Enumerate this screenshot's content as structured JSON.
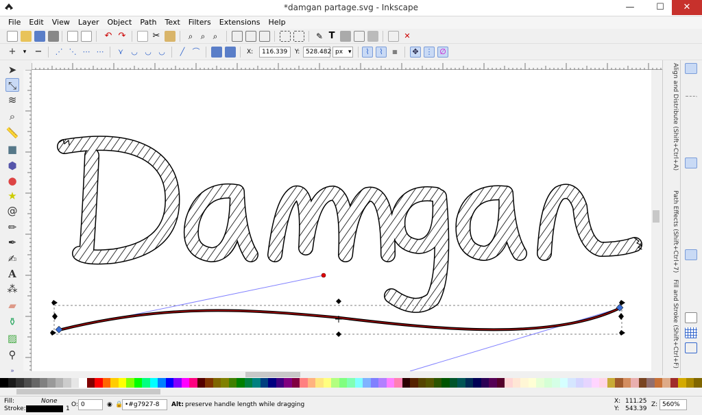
{
  "window": {
    "title": "*damgan partage.svg - Inkscape",
    "close": "✕",
    "minimize": "—",
    "maximize": "☐"
  },
  "menu": [
    "File",
    "Edit",
    "View",
    "Layer",
    "Object",
    "Path",
    "Text",
    "Filters",
    "Extensions",
    "Help"
  ],
  "node_toolbar": {
    "x_label": "X:",
    "x_value": "116.339",
    "y_label": "Y:",
    "y_value": "528.482",
    "unit": "px"
  },
  "dock_tabs": [
    "Align and Distribute (Shift+Ctrl+A)",
    "Path Effects (Shift+Ctrl+7)",
    "Fill and Stroke (Shift+Ctrl+F)"
  ],
  "artwork_text": "Damgan",
  "status": {
    "fill_label": "Fill:",
    "fill_value": "None",
    "stroke_label": "Stroke:",
    "stroke_width": "1",
    "opacity_label": "O:",
    "opacity_value": "0",
    "object_id": "•#g7927-8",
    "message_key": "Alt:",
    "message": "preserve handle length while dragging",
    "x_label": "X:",
    "x_value": "111.25",
    "y_label": "Y:",
    "y_value": "543.39",
    "zoom_label": "Z:",
    "zoom_value": "560%"
  },
  "colors": {
    "selection_blue": "#3c6fd6",
    "path_red": "#b00000",
    "handle_line": "#8080ff"
  },
  "palette": [
    "#000000",
    "#1a1a1a",
    "#333333",
    "#4d4d4d",
    "#666666",
    "#808080",
    "#999999",
    "#b3b3b3",
    "#cccccc",
    "#e6e6e6",
    "#ffffff",
    "#800000",
    "#ff0000",
    "#ff6600",
    "#ffcc00",
    "#ffff00",
    "#80ff00",
    "#00ff00",
    "#00ff80",
    "#00ffff",
    "#0080ff",
    "#0000ff",
    "#8000ff",
    "#ff00ff",
    "#ff0080",
    "#550000",
    "#803300",
    "#806600",
    "#808000",
    "#408000",
    "#008000",
    "#008040",
    "#008080",
    "#004080",
    "#000080",
    "#400080",
    "#800080",
    "#800040",
    "#ff8080",
    "#ffb380",
    "#ffe680",
    "#ffff80",
    "#b3ff80",
    "#80ff80",
    "#80ffb3",
    "#80ffff",
    "#80b3ff",
    "#8080ff",
    "#b380ff",
    "#ff80ff",
    "#ff80b3",
    "#2b0000",
    "#552200",
    "#554400",
    "#555500",
    "#2b5500",
    "#005500",
    "#00552b",
    "#005555",
    "#002b55",
    "#000055",
    "#2b0055",
    "#550055",
    "#55002b",
    "#ffd5d5",
    "#ffe6d5",
    "#fff6d5",
    "#ffffd5",
    "#e6ffd5",
    "#d5ffd5",
    "#d5ffe6",
    "#d5ffff",
    "#d5e6ff",
    "#d5d5ff",
    "#e6d5ff",
    "#ffd5ff",
    "#ffd5e6",
    "#c8ab37",
    "#a05a2c",
    "#d38d5f",
    "#e9afaf",
    "#784421",
    "#916f6f",
    "#c87137",
    "#deaa87",
    "#a02c2c",
    "#d4aa00",
    "#aa8800",
    "#806600"
  ]
}
